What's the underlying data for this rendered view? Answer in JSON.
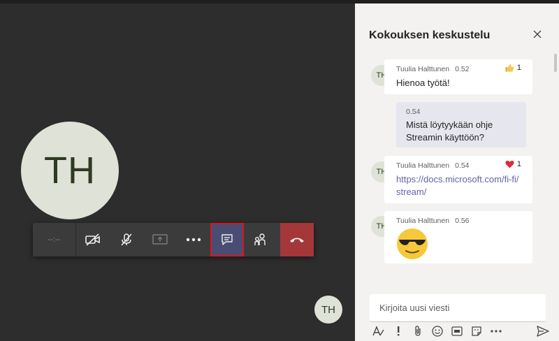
{
  "stage": {
    "big_avatar_initials": "TH",
    "small_avatar_initials": "TH"
  },
  "callbar": {
    "timer": "--:--",
    "buttons": [
      "camera-off-icon",
      "mic-off-icon",
      "share-screen-icon",
      "more-options-icon",
      "chat-icon",
      "participants-icon",
      "hang-up-icon"
    ],
    "active_button": "chat-icon",
    "hangup_color": "#a4373a"
  },
  "chat": {
    "title": "Kokouksen keskustelu",
    "messages": [
      {
        "initials": "TH",
        "author": "Tuulia Halttunen",
        "time": "0.52",
        "reaction_count": "1",
        "reaction_icon": "thumbs-up-icon",
        "text": "Hienoa työtä!"
      },
      {
        "own": true,
        "time": "0.54",
        "text": "Mistä löytyykään ohje Streamin käyttöön?"
      },
      {
        "initials": "TH",
        "author": "Tuulia Halttunen",
        "time": "0.54",
        "reaction_count": "1",
        "reaction_icon": "heart-icon",
        "link": "https://docs.microsoft.com/fi-fi/stream/"
      },
      {
        "initials": "TH",
        "author": "Tuulia Halttunen",
        "time": "0.56",
        "emoji": "sunglasses-emoji-icon"
      }
    ],
    "compose_placeholder": "Kirjoita uusi viesti",
    "compose_tools": [
      "format-icon",
      "important-icon",
      "attach-icon",
      "emoji-icon",
      "gif-icon",
      "sticker-icon",
      "more-options-icon",
      "send-icon"
    ]
  },
  "colors": {
    "stage_bg": "#2d2d2d",
    "panel_bg": "#f3f2f1",
    "accent": "#6264a7",
    "highlight_border": "#e0141e"
  }
}
